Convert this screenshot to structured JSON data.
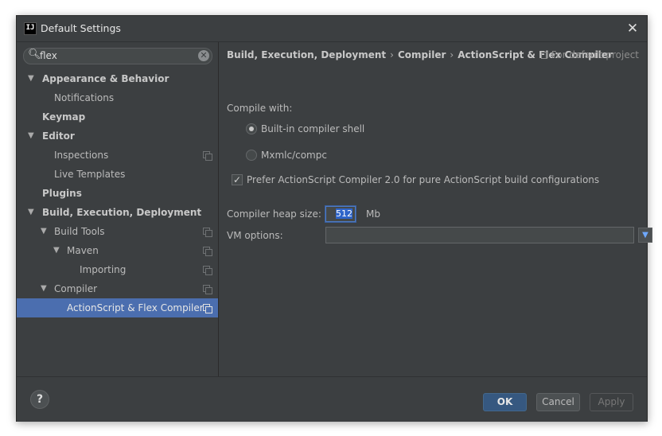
{
  "window": {
    "app_icon": "IJ",
    "title": "Default Settings",
    "close_icon": "✕"
  },
  "search": {
    "value": "flex",
    "search_icon": "search-icon",
    "clear_icon": "clear-icon"
  },
  "tree": [
    {
      "label": "Appearance & Behavior",
      "bold": true,
      "expanded": true
    },
    {
      "label": "Notifications",
      "bold": false
    },
    {
      "label": "Keymap",
      "bold": true
    },
    {
      "label": "Editor",
      "bold": true,
      "expanded": true
    },
    {
      "label": "Inspections",
      "bold": false
    },
    {
      "label": "Live Templates",
      "bold": false
    },
    {
      "label": "Plugins",
      "bold": true
    },
    {
      "label": "Build, Execution, Deployment",
      "bold": true,
      "expanded": true
    },
    {
      "label": "Build Tools",
      "bold": false,
      "expanded": true
    },
    {
      "label": "Maven",
      "bold": false,
      "expanded": true
    },
    {
      "label": "Importing",
      "bold": false
    },
    {
      "label": "Compiler",
      "bold": false,
      "expanded": true
    },
    {
      "label": "ActionScript & Flex Compiler",
      "bold": false,
      "selected": true
    }
  ],
  "breadcrumb": {
    "part1": "Build, Execution, Deployment",
    "sep": "›",
    "part2": "Compiler",
    "part3": "ActionScript & Flex Compiler",
    "scope": "For default project"
  },
  "form": {
    "compile_with_label": "Compile with:",
    "radio_builtin": "Built-in compiler shell",
    "radio_mxmlc": "Mxmlc/compc",
    "prefer_checkbox": "Prefer ActionScript Compiler 2.0 for pure ActionScript build configurations",
    "heap_label": "Compiler heap size:",
    "heap_value": "512",
    "heap_unit": "Mb",
    "vm_label": "VM options:",
    "vm_value": ""
  },
  "buttons": {
    "help": "?",
    "ok": "OK",
    "cancel": "Cancel",
    "apply": "Apply"
  },
  "colors": {
    "background": "#3c3f41",
    "selection": "#4b6eaf",
    "primary_button": "#365880"
  }
}
